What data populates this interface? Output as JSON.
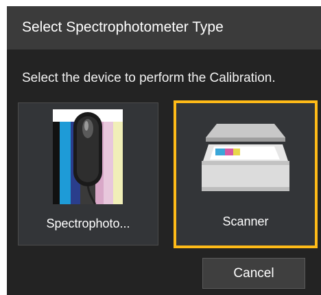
{
  "dialog": {
    "title": "Select Spectrophotometer Type",
    "prompt": "Select the device to perform the Calibration.",
    "options": [
      {
        "label": "Spectrophoto...",
        "icon": "spectrophotometer-icon",
        "selected": false
      },
      {
        "label": "Scanner",
        "icon": "scanner-icon",
        "selected": true
      }
    ],
    "cancel_label": "Cancel"
  },
  "colors": {
    "dialog_background": "#232323",
    "titlebar_background": "#3b3b3b",
    "tile_background": "#333538",
    "selection_border": "#ffbb18",
    "button_background": "#3f3f3f"
  }
}
